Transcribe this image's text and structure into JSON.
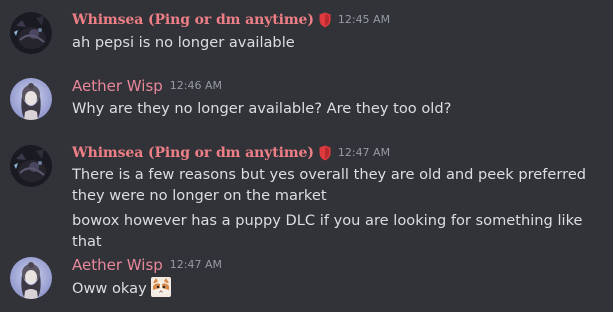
{
  "messages": [
    {
      "username": "Whimsea (Ping or dm anytime)",
      "timestamp": "12:45 AM",
      "lines": [
        "ah pepsi is no longer available"
      ]
    },
    {
      "username": "Aether Wisp",
      "timestamp": "12:46 AM",
      "lines": [
        "Why are they no longer available? Are they too old?"
      ]
    },
    {
      "username": "Whimsea (Ping or dm anytime)",
      "timestamp": "12:47 AM",
      "lines": [
        "There is a few reasons but yes overall they are old and peek preferred they were no longer on the market",
        "bowox however has a puppy DLC if you are looking for something like that"
      ]
    },
    {
      "username": "Aether Wisp",
      "timestamp": "12:47 AM",
      "lines": [
        "Oww okay"
      ]
    }
  ],
  "colors": {
    "background": "#313338",
    "whimsea_name": "#ef7f86",
    "aether_name": "#e8879a",
    "text": "#dbdee1",
    "timestamp": "#949ba4",
    "role_badge": "#e03a3e"
  },
  "icons": {
    "role_badge": "red-shield-role-icon",
    "emoji": "cat-face-emoji"
  }
}
